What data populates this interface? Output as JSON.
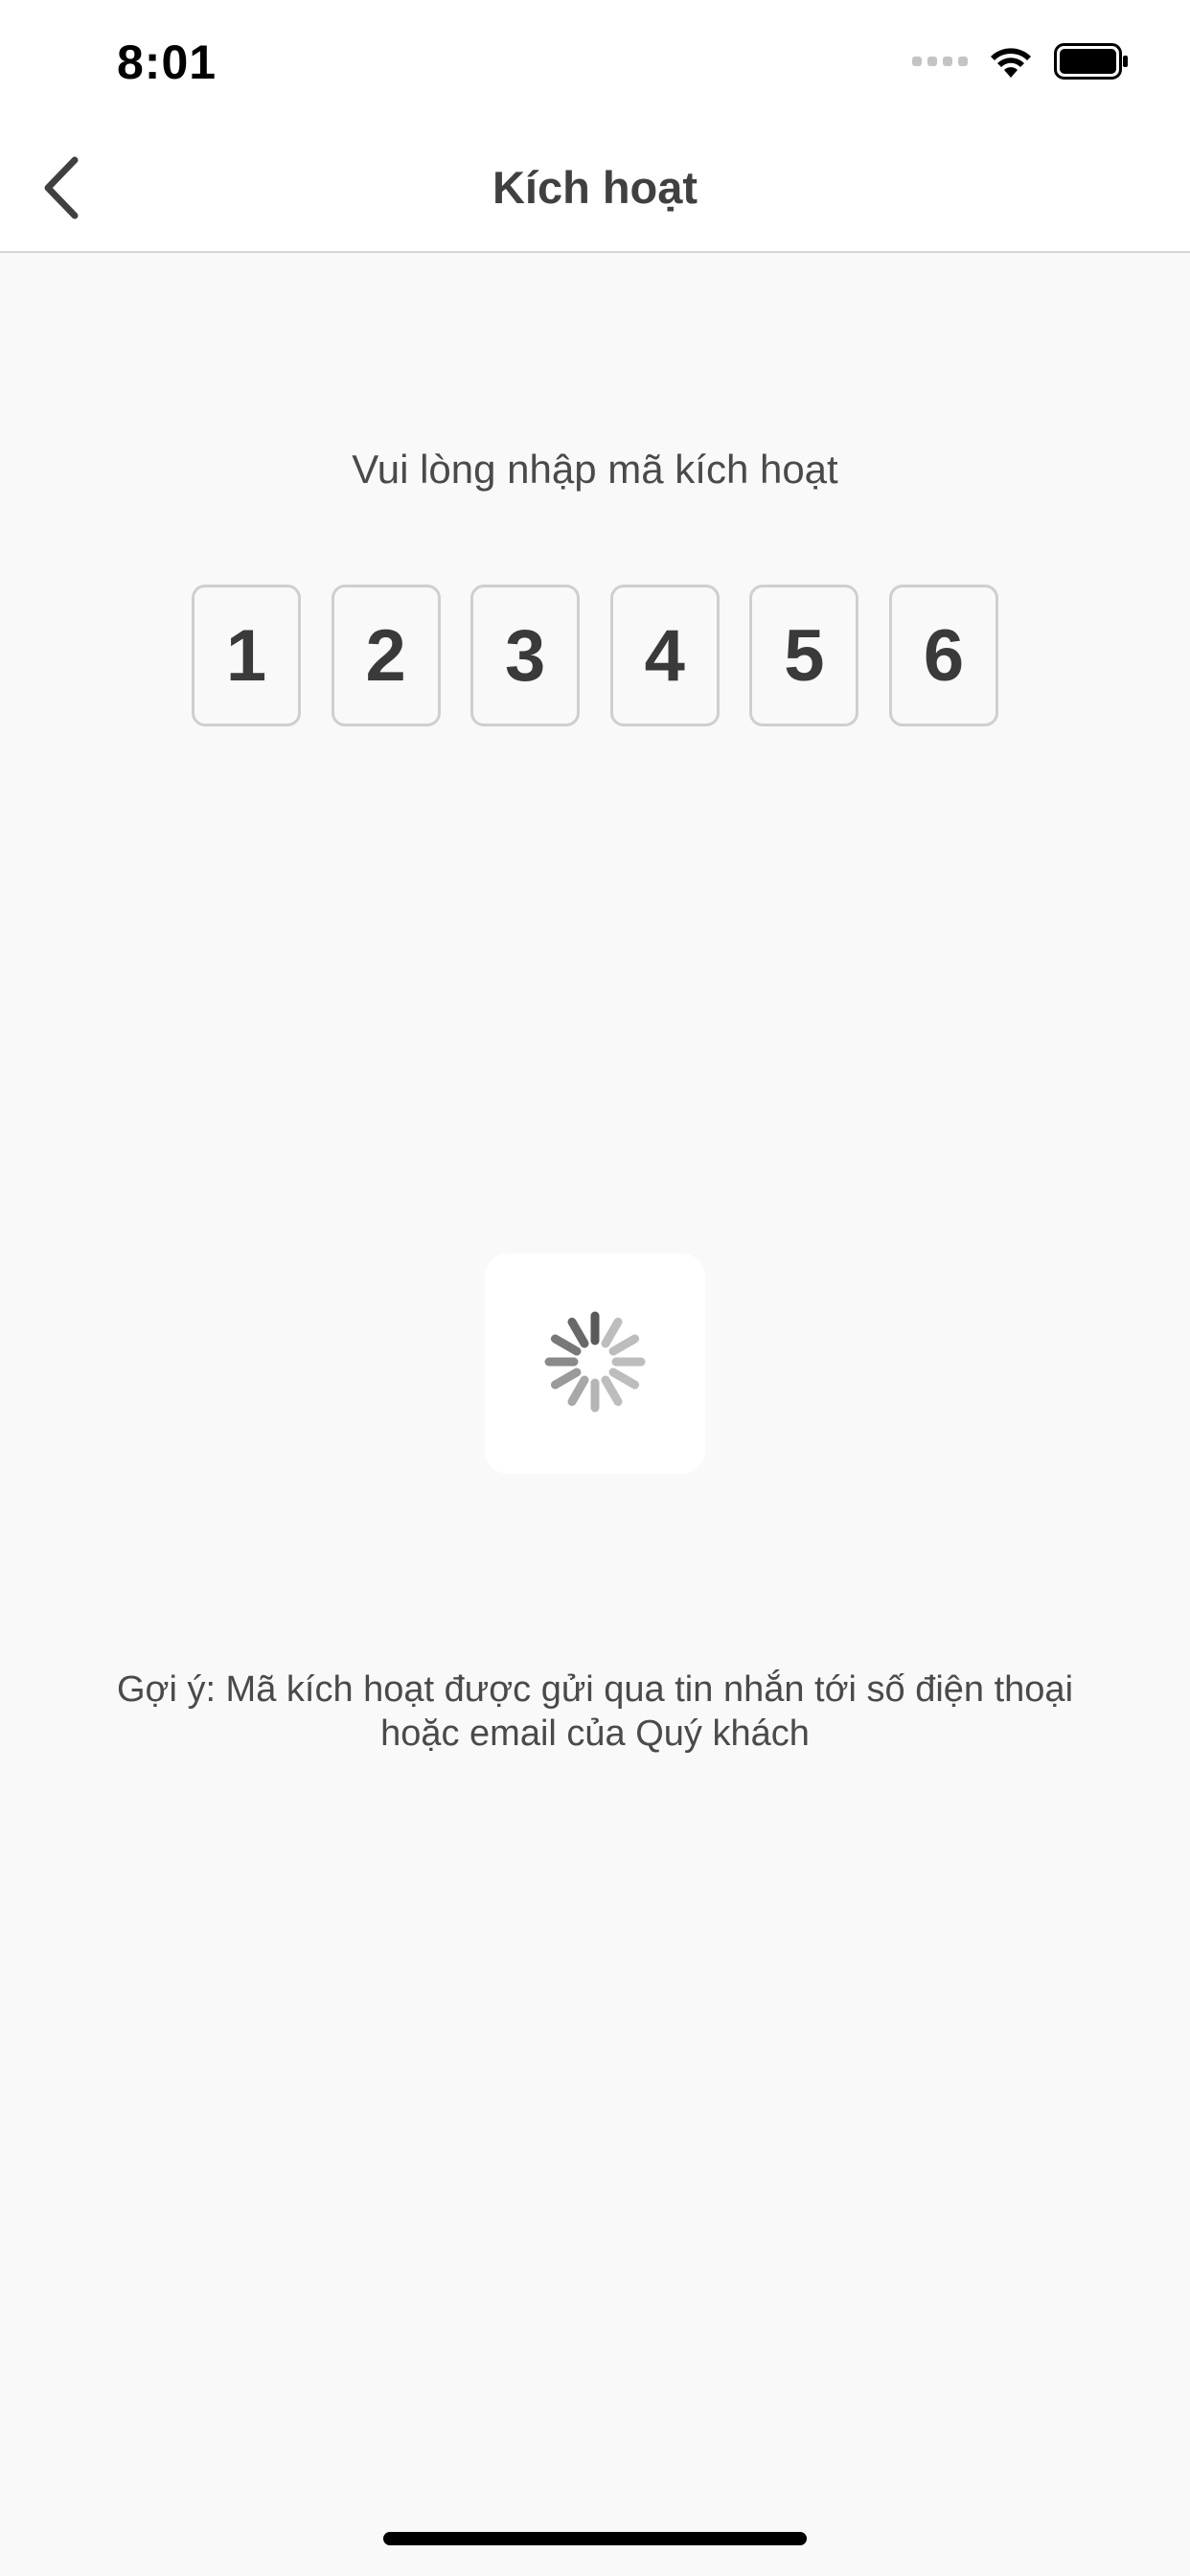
{
  "status_bar": {
    "time": "8:01",
    "icons": [
      "signal-dots-icon",
      "wifi-icon",
      "battery-icon"
    ]
  },
  "nav": {
    "back_icon": "chevron-left-icon",
    "title": "Kích hoạt"
  },
  "prompt": "Vui lòng nhập mã kích hoạt",
  "code": {
    "digits": [
      "1",
      "2",
      "3",
      "4",
      "5",
      "6"
    ]
  },
  "loading_icon": "activity-spinner-icon",
  "hint": {
    "line1": "Gợi ý: Mã kích hoạt được gửi qua tin nhắn tới số điện thoại",
    "line2": "hoặc email của Quý khách"
  },
  "colors": {
    "background": "#f9f9f9",
    "text": "#3a3a3a",
    "box_border": "#cfcfcf"
  }
}
